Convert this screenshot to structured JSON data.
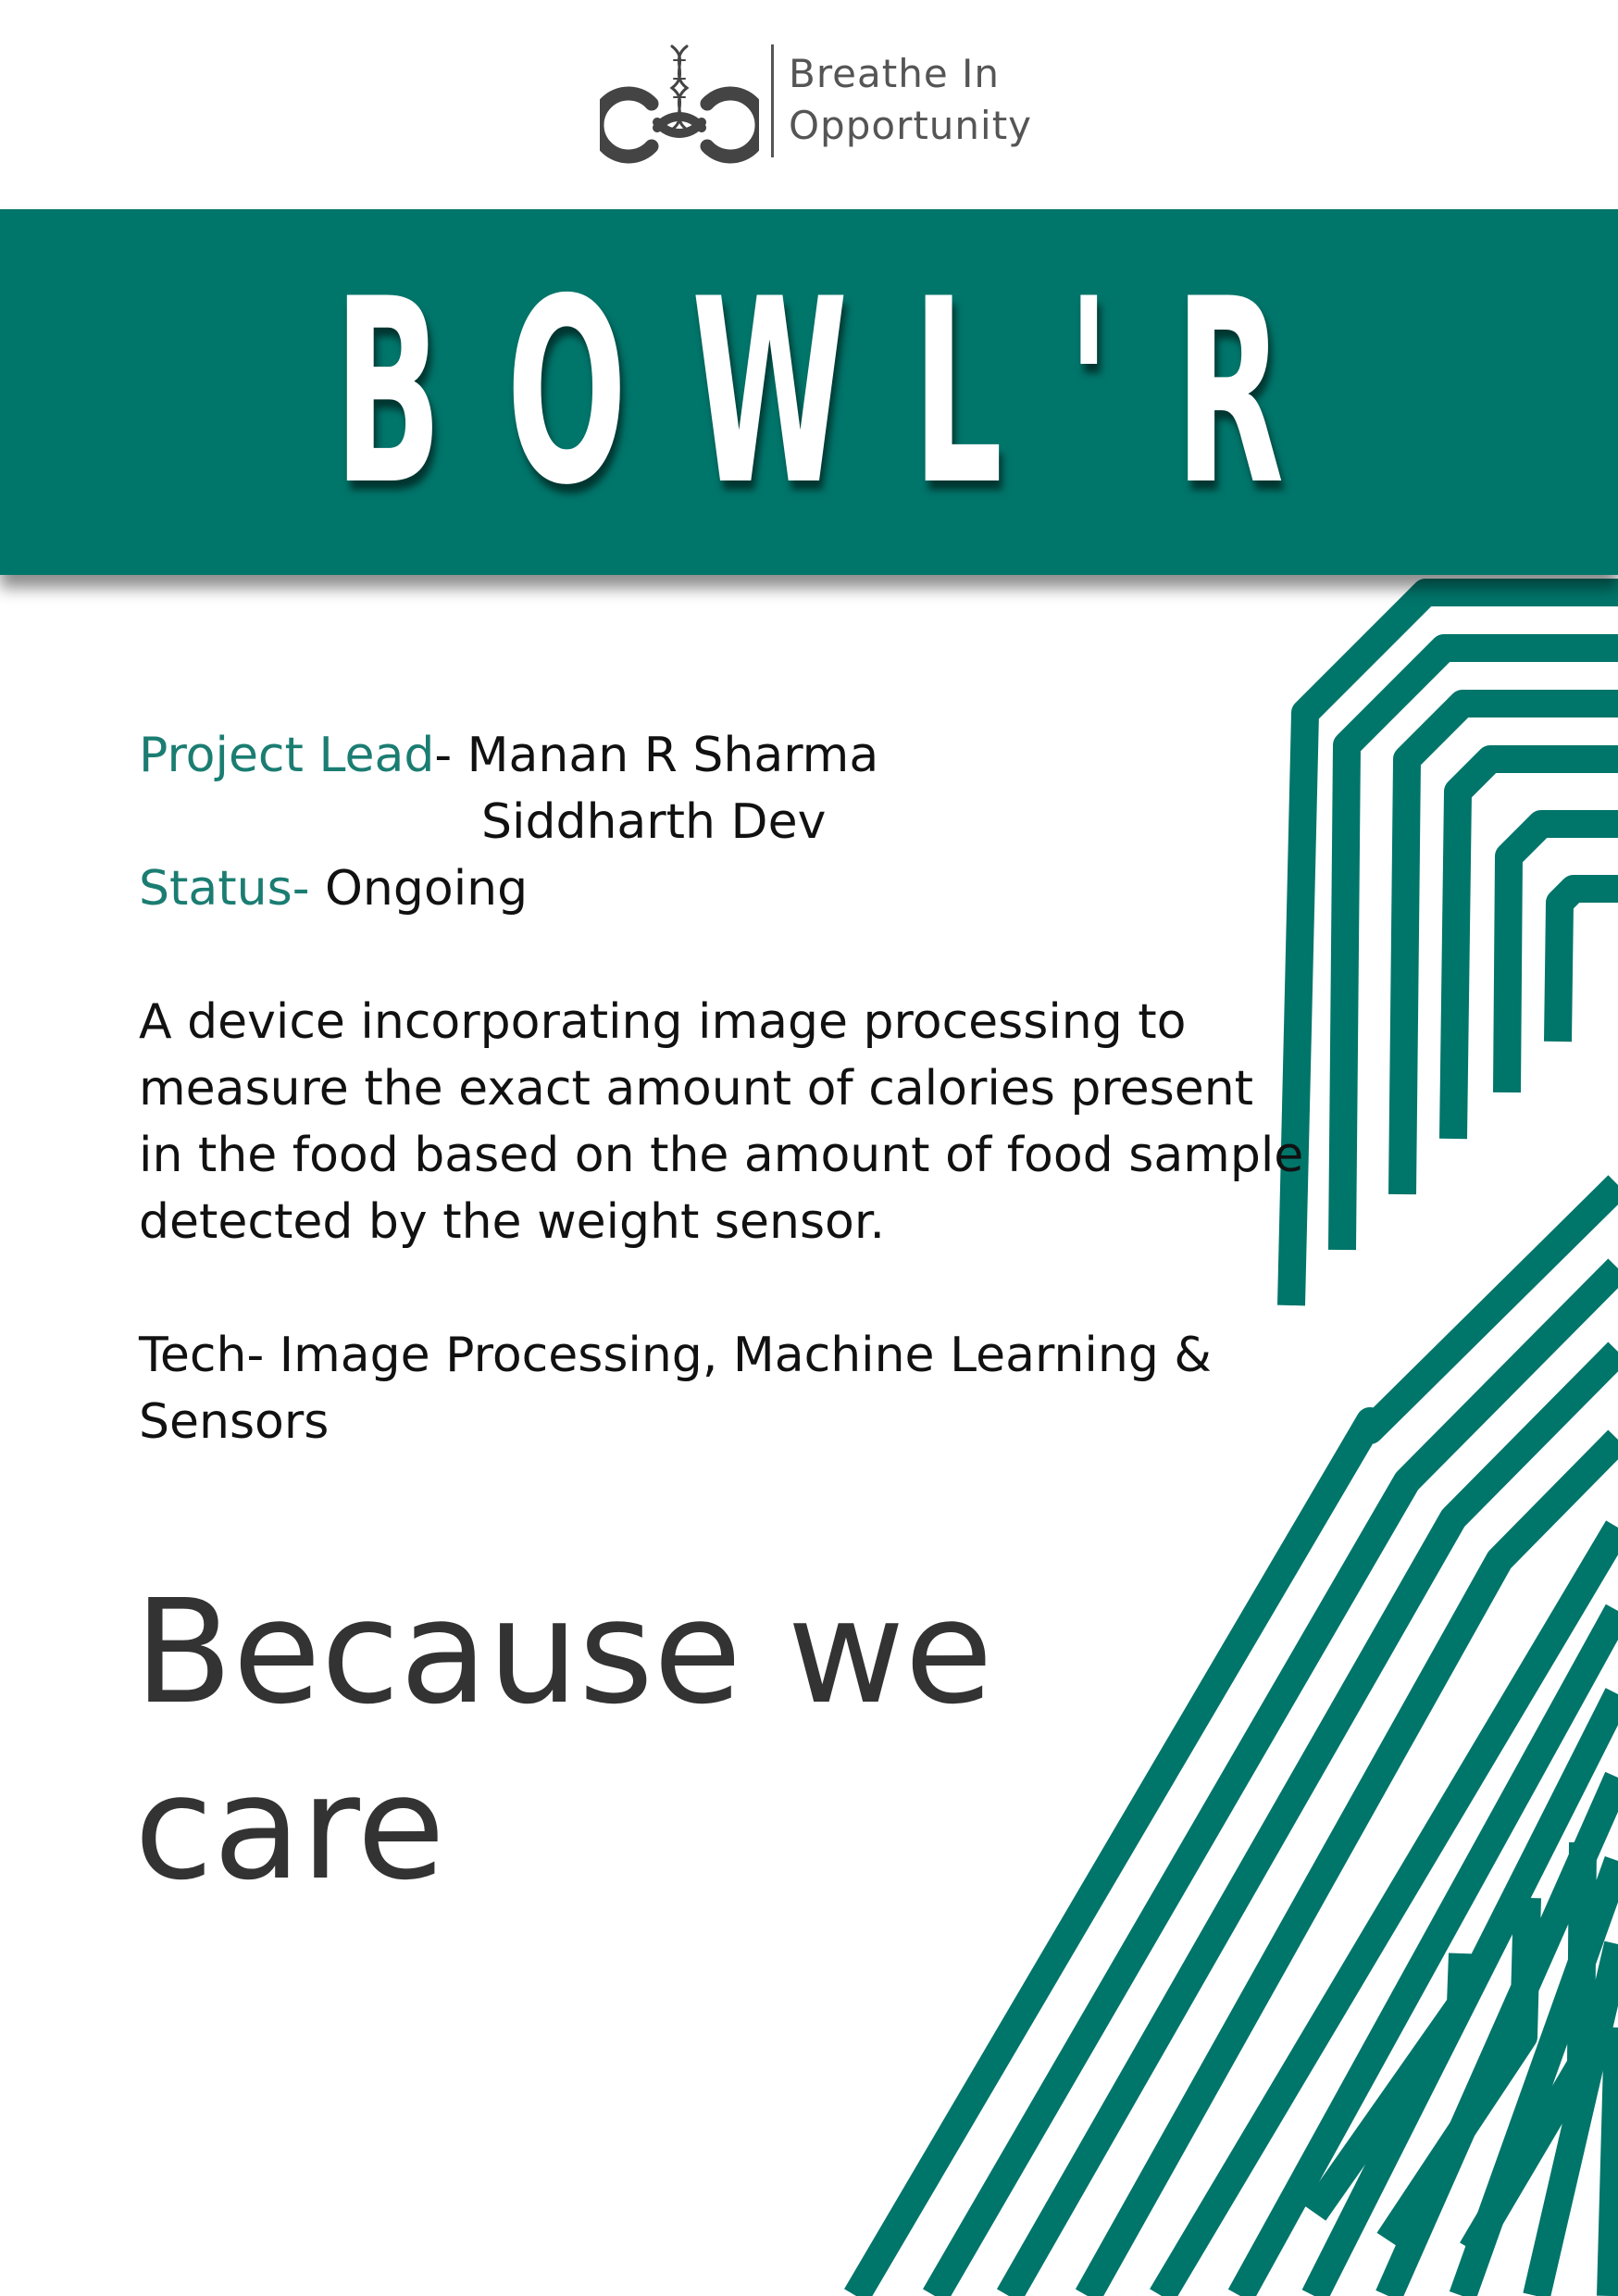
{
  "header": {
    "tagline_line1": "Breathe In",
    "tagline_line2": "Opportunity"
  },
  "banner": {
    "title": "BOWL'R"
  },
  "project": {
    "lead_label": "Project Lead",
    "lead_separator": "- ",
    "lead_names": [
      "Manan R Sharma",
      "Siddharth Dev"
    ],
    "status_label": "Status- ",
    "status_value": "Ongoing"
  },
  "description": {
    "lines": [
      "A device incorporating image processing to",
      "measure the exact amount of calories present",
      "in the food based on the amount of food sample",
      "detected by the weight sensor."
    ]
  },
  "tech": {
    "lines": [
      "Tech- Image Processing, Machine Learning &",
      "Sensors"
    ]
  },
  "slogan": {
    "lines": [
      "Because we",
      "care"
    ]
  },
  "colors": {
    "brand_teal": "#00756a",
    "accent_text": "#1b7d72",
    "dark_text": "#333333"
  }
}
